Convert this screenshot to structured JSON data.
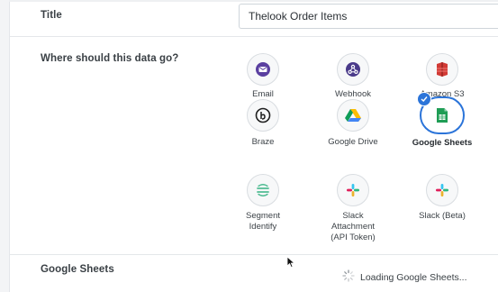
{
  "title_row": {
    "label": "Title",
    "value": "Thelook Order Items"
  },
  "destination_row": {
    "label": "Where should this data go?",
    "options": [
      {
        "name": "Email",
        "icon": "email-icon",
        "color": "#5a3fa0",
        "selected": false
      },
      {
        "name": "Webhook",
        "icon": "webhook-icon",
        "color": "#4a3a8a",
        "selected": false
      },
      {
        "name": "Amazon S3",
        "icon": "amazon-s3-icon",
        "color": "#d13a35",
        "selected": false
      },
      {
        "name": "Braze",
        "icon": "braze-icon",
        "color": "#1f1f1f",
        "selected": false
      },
      {
        "name": "Google Drive",
        "icon": "google-drive-icon",
        "color": "#1e88e5",
        "selected": false
      },
      {
        "name": "Google Sheets",
        "icon": "google-sheets-icon",
        "color": "#1f9d55",
        "selected": true
      },
      {
        "name": "Segment\nIdentify",
        "icon": "segment-icon",
        "color": "#52bd94",
        "selected": false
      },
      {
        "name": "Slack\nAttachment\n(API Token)",
        "icon": "slack-icon",
        "color": "#4a154b",
        "selected": false
      },
      {
        "name": "Slack (Beta)",
        "icon": "slack-icon",
        "color": "#4a154b",
        "selected": false
      }
    ]
  },
  "sheets_row": {
    "label": "Google Sheets",
    "loading_text": "Loading Google Sheets..."
  },
  "colors": {
    "accent": "#2b74d9",
    "text": "#262d33"
  }
}
